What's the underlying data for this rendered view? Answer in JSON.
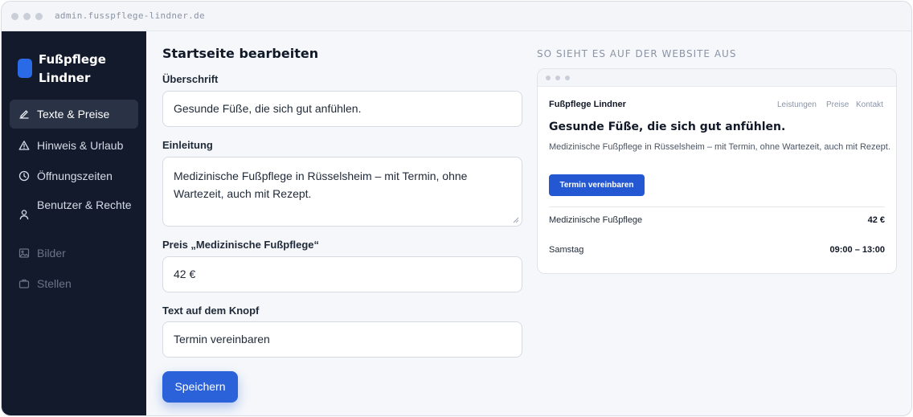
{
  "browser": {
    "url": "admin.fusspflege-lindner.de"
  },
  "sidebar": {
    "brand": "Fußpflege Lindner",
    "items": [
      {
        "label": "Texte & Preise",
        "icon": "pencil-icon",
        "state": "active"
      },
      {
        "label": "Hinweis & Urlaub",
        "icon": "warning-icon",
        "state": "normal"
      },
      {
        "label": "Öffnungszeiten",
        "icon": "clock-icon",
        "state": "normal"
      },
      {
        "label": "Benutzer & Rechte",
        "icon": "user-icon",
        "state": "normal"
      },
      {
        "label": "Bilder",
        "icon": "image-icon",
        "state": "disabled"
      },
      {
        "label": "Stellen",
        "icon": "briefcase-icon",
        "state": "disabled"
      }
    ]
  },
  "editor": {
    "title": "Startseite bearbeiten",
    "fields": {
      "headline": {
        "label": "Überschrift",
        "value": "Gesunde Füße, die sich gut anfühlen."
      },
      "intro": {
        "label": "Einleitung",
        "value": "Medizinische Fußpflege in Rüsselsheim – mit Termin, ohne Wartezeit, auch mit Rezept."
      },
      "price": {
        "label": "Preis „Medizinische Fußpflege“",
        "value": "42 €"
      },
      "button_text": {
        "label": "Text auf dem Knopf",
        "value": "Termin vereinbaren"
      }
    },
    "save_label": "Speichern"
  },
  "preview": {
    "heading": "SO SIEHT ES AUF DER WEBSITE AUS",
    "brand": "Fußpflege Lindner",
    "nav": [
      "Leistungen",
      "Preise",
      "Kontakt"
    ],
    "title": "Gesunde Füße, die sich gut anfühlen.",
    "subtitle": "Medizinische Fußpflege in Rüsselsheim – mit Termin, ohne Wartezeit, auch mit Rezept.",
    "cta": "Termin vereinbaren",
    "rows": [
      {
        "label": "Medizinische Fußpflege",
        "value": "42 €"
      },
      {
        "label": "Samstag",
        "value": "09:00 – 13:00"
      }
    ]
  },
  "colors": {
    "accent": "#2b62d9",
    "sidebar_bg": "#121a2c",
    "page_bg": "#f5f7fa"
  }
}
